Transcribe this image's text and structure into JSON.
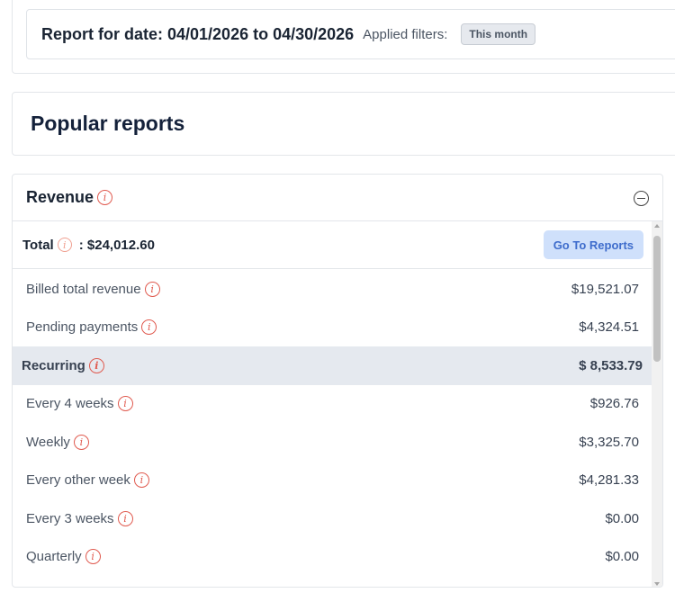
{
  "report": {
    "date_text": "Report for date: 04/01/2026 to 04/30/2026",
    "filters_label": "Applied filters:",
    "filter_chip": "This month"
  },
  "popular": {
    "title": "Popular reports"
  },
  "revenue": {
    "title": "Revenue",
    "total_label": "Total",
    "total_value": ": $24,012.60",
    "go_reports_label": "Go To Reports",
    "rows": [
      {
        "label": "Billed total revenue",
        "value": "$19,521.07"
      },
      {
        "label": "Pending payments",
        "value": "$4,324.51"
      },
      {
        "label": "Recurring",
        "value": "$ 8,533.79"
      },
      {
        "label": "Every 4 weeks",
        "value": "$926.76"
      },
      {
        "label": "Weekly",
        "value": "$3,325.70"
      },
      {
        "label": "Every other week",
        "value": "$4,281.33"
      },
      {
        "label": "Every 3 weeks",
        "value": "$0.00"
      },
      {
        "label": "Quarterly",
        "value": "$0.00"
      }
    ]
  },
  "icons": {
    "info": "i"
  }
}
